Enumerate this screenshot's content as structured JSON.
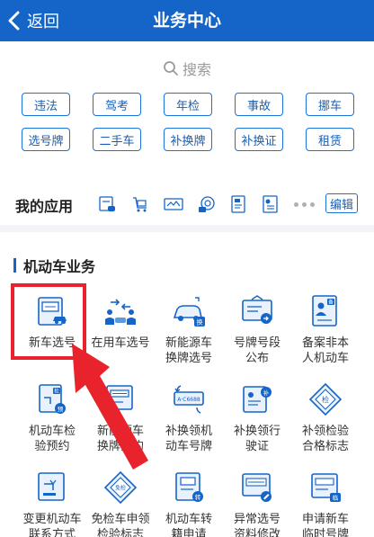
{
  "header": {
    "back_label": "返回",
    "title": "业务中心"
  },
  "search": {
    "placeholder": "搜索"
  },
  "tags": [
    "违法",
    "驾考",
    "年检",
    "事故",
    "挪车",
    "选号牌",
    "二手车",
    "补换牌",
    "补换证",
    "租赁"
  ],
  "my_apps": {
    "title": "我的应用",
    "icons": [
      "new-car-app-icon",
      "cart-app-icon",
      "plate-card-app-icon",
      "license-app-icon",
      "document-app-icon",
      "certificate-app-icon"
    ],
    "edit_label": "编辑"
  },
  "section": {
    "title": "机动车业务",
    "items": [
      {
        "label": "新车选号",
        "icon": "new-car-plate-icon"
      },
      {
        "label": "在用车选号",
        "icon": "used-car-people-icon"
      },
      {
        "label": "新能源车\n换牌选号",
        "icon": "new-energy-car-icon"
      },
      {
        "label": "号牌号段\n公布",
        "icon": "plate-range-icon"
      },
      {
        "label": "备案非本\n人机动车",
        "icon": "record-vehicle-icon"
      },
      {
        "label": "机动车检\n验预约",
        "icon": "inspection-booking-icon"
      },
      {
        "label": "新能源车\n换牌预约",
        "icon": "new-energy-booking-icon"
      },
      {
        "label": "补换领机\n动车号牌",
        "icon": "replace-plate-icon"
      },
      {
        "label": "补换领行\n驶证",
        "icon": "replace-license-icon"
      },
      {
        "label": "补领检验\n合格标志",
        "icon": "inspection-mark-icon"
      },
      {
        "label": "变更机动车\n联系方式",
        "icon": "change-contact-icon"
      },
      {
        "label": "免检车申领\n检验标志",
        "icon": "exempt-mark-icon"
      },
      {
        "label": "机动车转\n籍申请",
        "icon": "transfer-icon"
      },
      {
        "label": "异常选号\n资料修改",
        "icon": "abnormal-edit-icon"
      },
      {
        "label": "申请新车\n临时号牌",
        "icon": "temp-plate-icon"
      }
    ]
  },
  "colors": {
    "primary": "#1565c8",
    "highlight": "#e8232b",
    "accent_blue": "#1a73d9"
  }
}
